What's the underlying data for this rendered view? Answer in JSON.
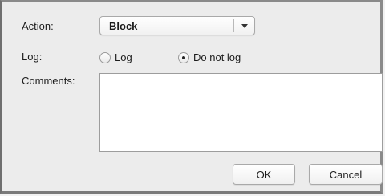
{
  "form": {
    "action_label": "Action:",
    "action_value": "Block",
    "log_label": "Log:",
    "log_options": [
      {
        "label": "Log",
        "selected": false
      },
      {
        "label": "Do not log",
        "selected": true
      }
    ],
    "comments_label": "Comments:",
    "comments_value": ""
  },
  "buttons": {
    "ok": "OK",
    "cancel": "Cancel"
  }
}
